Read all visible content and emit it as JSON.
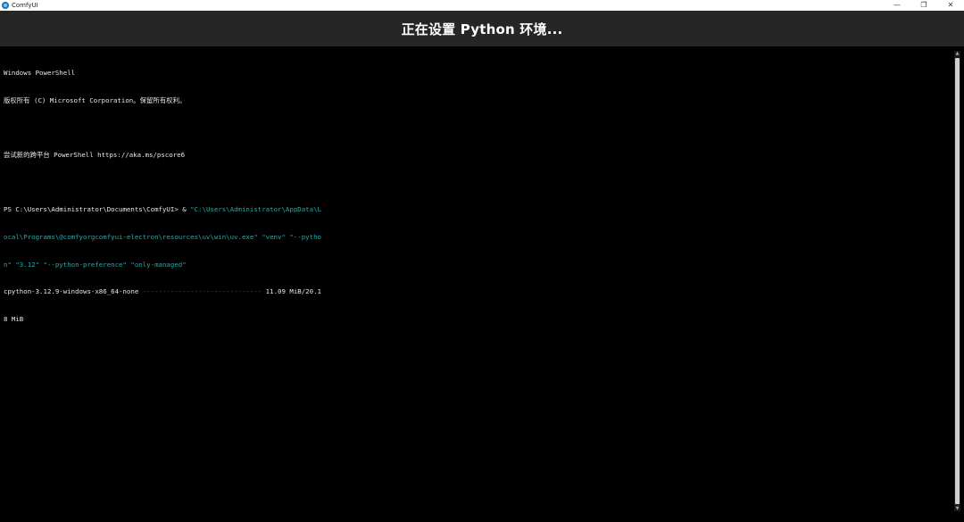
{
  "window": {
    "app_title": "ComfyUI",
    "controls": {
      "minimize": "—",
      "restore": "❐",
      "close": "✕"
    }
  },
  "header": {
    "title": "正在设置 Python 环境..."
  },
  "terminal": {
    "lines": [
      "Windows PowerShell",
      "版权所有 (C) Microsoft Corporation。保留所有权利。",
      "",
      "尝试新的跨平台 PowerShell https://aka.ms/pscore6",
      ""
    ],
    "prompt": "PS C:\\Users\\Administrator\\Documents\\ComfyUI> & ",
    "cmd_line1": "\"C:\\Users\\Administrator\\AppData\\L",
    "cmd_line2": "ocal\\Programs\\@comfyorgcomfyui-electron\\resources\\uv\\win\\uv.exe\" \"venv\" \"--pytho",
    "cmd_line3": "n\" \"3.12\" \"--python-preference\" \"only-managed\"",
    "progress_label": "cpython-3.12.9-windows-x86_64-none ",
    "progress_bar": "------------------------------",
    "progress_value": " 11.09 MiB/20.1",
    "progress_value_cont": "8 MiB"
  },
  "colors": {
    "teal": "#2aa8a8",
    "header_bg": "#262626",
    "terminal_bg": "#000000"
  }
}
